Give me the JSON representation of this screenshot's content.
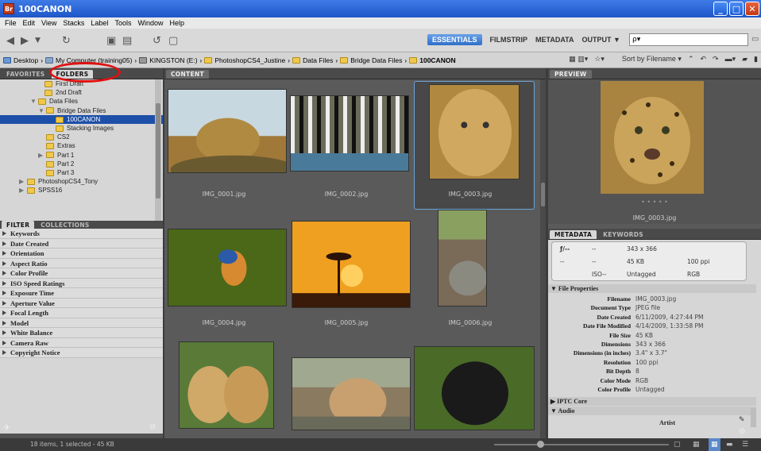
{
  "app": {
    "title": "100CANON",
    "icon_label": "Br"
  },
  "menu": [
    "File",
    "Edit",
    "View",
    "Stacks",
    "Label",
    "Tools",
    "Window",
    "Help"
  ],
  "workspaces": {
    "essentials": "ESSENTIALS",
    "filmstrip": "FILMSTRIP",
    "metadata": "METADATA",
    "output": "OUTPUT ▼"
  },
  "search": {
    "placeholder": "ρ▾"
  },
  "path": {
    "items": [
      "Desktop",
      "My Computer (training05)",
      "KINGSTON (E:)",
      "PhotoshopCS4_Justine",
      "Data Files",
      "Bridge Data Files",
      "100CANON"
    ],
    "sort_label": "Sort by Filename ▾"
  },
  "tabs": {
    "favorites": "FAVORITES",
    "folders": "FOLDERS",
    "content": "CONTENT",
    "preview": "PREVIEW",
    "filter": "FILTER",
    "collections": "COLLECTIONS",
    "metadata": "METADATA",
    "keywords": "KEYWORDS"
  },
  "tree": [
    {
      "label": "First Draft",
      "indent": 66,
      "arrow": false
    },
    {
      "label": "2nd Draft",
      "indent": 66,
      "arrow": false
    },
    {
      "label": "Data Files",
      "indent": 58,
      "arrow": true
    },
    {
      "label": "Bridge Data Files",
      "indent": 68,
      "arrow": true
    },
    {
      "label": "100CANON",
      "indent": 80,
      "arrow": false,
      "selected": true
    },
    {
      "label": "Stacking Images",
      "indent": 80,
      "arrow": false
    },
    {
      "label": "CS2",
      "indent": 68,
      "arrow": false
    },
    {
      "label": "Extras",
      "indent": 68,
      "arrow": false
    },
    {
      "label": "Part 1",
      "indent": 68,
      "arrow": true
    },
    {
      "label": "Part 2",
      "indent": 68,
      "arrow": false
    },
    {
      "label": "Part 3",
      "indent": 68,
      "arrow": false
    },
    {
      "label": "PhotoshopCS4_Tony",
      "indent": 44,
      "arrow": true
    },
    {
      "label": "SPSS16",
      "indent": 44,
      "arrow": true
    }
  ],
  "filters": [
    "Keywords",
    "Date Created",
    "Orientation",
    "Aspect Ratio",
    "Color Profile",
    "ISO Speed Ratings",
    "Exposure Time",
    "Aperture Value",
    "Focal Length",
    "Model",
    "White Balance",
    "Camera Raw",
    "Copyright Notice"
  ],
  "thumbnails": [
    {
      "file": "IMG_0001.jpg",
      "subject": "lion-photo",
      "color": "#a07838"
    },
    {
      "file": "IMG_0002.jpg",
      "subject": "zebras-photo",
      "color": "#6b6b5a"
    },
    {
      "file": "IMG_0003.jpg",
      "subject": "leopard-photo",
      "color": "#b08840"
    },
    {
      "file": "IMG_0004.jpg",
      "subject": "kingfisher-photo",
      "color": "#4a6a1a"
    },
    {
      "file": "IMG_0005.jpg",
      "subject": "sunset-giraffe-photo",
      "color": "#e68a10"
    },
    {
      "file": "IMG_0006.jpg",
      "subject": "rhino-photo",
      "color": "#7a6a58"
    },
    {
      "file": "",
      "subject": "cheetah-cubs-photo",
      "color": "#b08850"
    },
    {
      "file": "",
      "subject": "lion-cub-photo",
      "color": "#8a7a60"
    },
    {
      "file": "",
      "subject": "gorilla-photo",
      "color": "#2f3a22"
    }
  ],
  "preview": {
    "caption": "IMG_0003.jpg",
    "dots": "• • • • •"
  },
  "metabox": {
    "aperture": "ƒ/--",
    "dash1": "--",
    "dash2": "--",
    "dash3": "--",
    "iso": "ISO--",
    "dims": "343 x 366",
    "size": "45 KB",
    "ppi": "100 ppi",
    "tag": "Untagged",
    "mode": "RGB"
  },
  "file_properties": {
    "heading": "File Properties",
    "rows": [
      {
        "k": "Filename",
        "v": "IMG_0003.jpg"
      },
      {
        "k": "Document Type",
        "v": "JPEG file"
      },
      {
        "k": "Date Created",
        "v": "6/11/2009, 4:27:44 PM"
      },
      {
        "k": "Date File Modified",
        "v": "4/14/2009, 1:33:58 PM"
      },
      {
        "k": "File Size",
        "v": "45 KB"
      },
      {
        "k": "Dimensions",
        "v": "343 x 366"
      },
      {
        "k": "Dimensions (in inches)",
        "v": "3.4\" x 3.7\""
      },
      {
        "k": "Resolution",
        "v": "100 ppi"
      },
      {
        "k": "Bit Depth",
        "v": "8"
      },
      {
        "k": "Color Mode",
        "v": "RGB"
      },
      {
        "k": "Color Profile",
        "v": "Untagged"
      }
    ]
  },
  "iptc": "IPTC Core",
  "audio": "Audio",
  "artist": "Artist",
  "status": "18 items, 1 selected - 45 KB"
}
